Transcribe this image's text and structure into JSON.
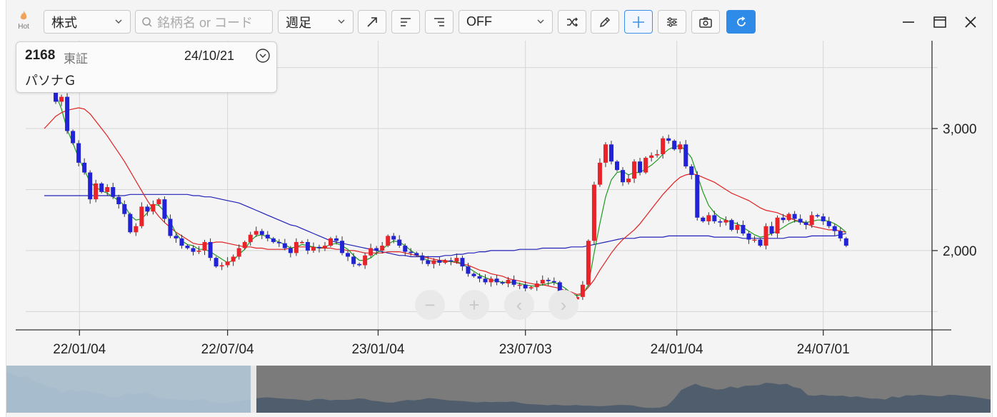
{
  "toolbar": {
    "hot_label": "Hot",
    "market_select": "株式",
    "search_placeholder": "銘柄名 or コード",
    "period_select": "週足",
    "indicator_select": "OFF"
  },
  "info_card": {
    "code": "2168",
    "exchange": "東証",
    "date": "24/10/21",
    "name": "パソナＧ"
  },
  "colors": {
    "up": "#e8232a",
    "down": "#2323d6",
    "ma_short": "#1f9a1f",
    "ma_mid": "#e02020",
    "ma_long": "#2020b8",
    "accent": "#2e8be8"
  },
  "chart_data": {
    "type": "candlestick",
    "y_ticks": [
      "3,000",
      "2,000"
    ],
    "x_ticks": [
      "22/01/04",
      "22/07/04",
      "23/01/04",
      "23/07/03",
      "24/01/04",
      "24/07/01"
    ],
    "ylim": [
      1350,
      3720
    ],
    "x_start": "2021-11-22",
    "x_interval": "weekly",
    "close": [
      3450,
      3350,
      3220,
      3260,
      2980,
      2880,
      2720,
      2640,
      2420,
      2550,
      2480,
      2520,
      2440,
      2380,
      2300,
      2150,
      2200,
      2360,
      2320,
      2380,
      2420,
      2260,
      2120,
      2100,
      2040,
      2020,
      1990,
      2000,
      2070,
      1940,
      1870,
      1880,
      1910,
      1950,
      2020,
      2070,
      2130,
      2160,
      2130,
      2100,
      2070,
      2060,
      2020,
      1980,
      2070,
      2070,
      2000,
      2030,
      2020,
      2040,
      2100,
      2080,
      1980,
      1950,
      1890,
      1880,
      1960,
      2020,
      2000,
      2040,
      2120,
      2090,
      2040,
      1990,
      1980,
      1960,
      1920,
      1890,
      1920,
      1900,
      1920,
      1910,
      1940,
      1870,
      1810,
      1790,
      1770,
      1740,
      1770,
      1740,
      1730,
      1760,
      1720,
      1720,
      1690,
      1700,
      1730,
      1760,
      1750,
      1740,
      1660,
      1610,
      1600,
      1620,
      1720,
      2080,
      2540,
      2720,
      2870,
      2730,
      2660,
      2560,
      2590,
      2730,
      2640,
      2760,
      2780,
      2790,
      2920,
      2900,
      2830,
      2870,
      2690,
      2620,
      2270,
      2240,
      2290,
      2240,
      2230,
      2250,
      2170,
      2210,
      2140,
      2090,
      2090,
      2040,
      2200,
      2140,
      2270,
      2250,
      2300,
      2260,
      2230,
      2210,
      2290,
      2280,
      2240,
      2200,
      2160,
      2100,
      2040
    ],
    "ma_short": [
      3430,
      3380,
      3280,
      3160,
      2990,
      2880,
      2760,
      2660,
      2560,
      2520,
      2490,
      2470,
      2440,
      2410,
      2370,
      2290,
      2250,
      2260,
      2310,
      2380,
      2370,
      2320,
      2240,
      2140,
      2080,
      2050,
      2040,
      2010,
      2010,
      1990,
      1960,
      1930,
      1900,
      1920,
      1970,
      2010,
      2080,
      2120,
      2130,
      2110,
      2090,
      2070,
      2050,
      2020,
      2030,
      2050,
      2040,
      2030,
      2020,
      2030,
      2050,
      2060,
      2040,
      2010,
      1960,
      1920,
      1920,
      1940,
      1980,
      2010,
      2050,
      2080,
      2070,
      2040,
      2000,
      1970,
      1940,
      1920,
      1910,
      1910,
      1910,
      1910,
      1910,
      1890,
      1860,
      1830,
      1800,
      1780,
      1760,
      1750,
      1740,
      1740,
      1740,
      1730,
      1720,
      1710,
      1710,
      1720,
      1730,
      1740,
      1720,
      1690,
      1650,
      1630,
      1640,
      1720,
      1980,
      2220,
      2440,
      2580,
      2640,
      2650,
      2620,
      2640,
      2640,
      2670,
      2700,
      2740,
      2790,
      2830,
      2850,
      2860,
      2820,
      2760,
      2620,
      2480,
      2370,
      2310,
      2270,
      2250,
      2230,
      2220,
      2190,
      2160,
      2130,
      2110,
      2120,
      2140,
      2160,
      2190,
      2220,
      2240,
      2240,
      2230,
      2240,
      2250,
      2250,
      2240,
      2220,
      2190,
      2150
    ],
    "ma_mid": [
      3000,
      3050,
      3100,
      3130,
      3150,
      3160,
      3170,
      3160,
      3120,
      3060,
      3000,
      2940,
      2870,
      2800,
      2730,
      2650,
      2570,
      2490,
      2410,
      2340,
      2280,
      2230,
      2190,
      2150,
      2120,
      2090,
      2060,
      2050,
      2050,
      2060,
      2070,
      2070,
      2060,
      2050,
      2040,
      2030,
      2030,
      2020,
      2020,
      2010,
      2010,
      2010,
      2010,
      2020,
      2030,
      2030,
      2030,
      2030,
      2020,
      2020,
      2020,
      2010,
      2010,
      2000,
      2000,
      1990,
      1980,
      1980,
      1980,
      1980,
      1990,
      1990,
      1990,
      1980,
      1970,
      1960,
      1950,
      1940,
      1930,
      1920,
      1920,
      1910,
      1900,
      1890,
      1880,
      1860,
      1840,
      1830,
      1810,
      1800,
      1790,
      1770,
      1760,
      1750,
      1740,
      1730,
      1720,
      1720,
      1710,
      1700,
      1690,
      1670,
      1660,
      1640,
      1650,
      1700,
      1760,
      1840,
      1910,
      1980,
      2040,
      2090,
      2130,
      2170,
      2220,
      2280,
      2340,
      2400,
      2460,
      2510,
      2560,
      2600,
      2620,
      2630,
      2620,
      2600,
      2580,
      2560,
      2530,
      2500,
      2470,
      2450,
      2430,
      2410,
      2380,
      2350,
      2330,
      2320,
      2310,
      2290,
      2270,
      2250,
      2240,
      2220,
      2200,
      2190,
      2180,
      2170,
      2170,
      2160,
      2150
    ],
    "ma_long": [
      2450,
      2450,
      2450,
      2450,
      2450,
      2450,
      2450,
      2450,
      2450,
      2450,
      2450,
      2450,
      2450,
      2450,
      2450,
      2460,
      2460,
      2460,
      2460,
      2460,
      2460,
      2460,
      2460,
      2460,
      2460,
      2460,
      2450,
      2450,
      2440,
      2440,
      2430,
      2420,
      2410,
      2400,
      2390,
      2370,
      2350,
      2330,
      2310,
      2290,
      2270,
      2250,
      2230,
      2210,
      2200,
      2180,
      2160,
      2140,
      2120,
      2100,
      2080,
      2070,
      2060,
      2050,
      2040,
      2030,
      2020,
      2010,
      2000,
      1990,
      1980,
      1970,
      1960,
      1960,
      1950,
      1950,
      1950,
      1950,
      1950,
      1950,
      1960,
      1960,
      1970,
      1970,
      1980,
      1980,
      1990,
      1990,
      2000,
      2000,
      2000,
      2000,
      2000,
      2010,
      2010,
      2010,
      2010,
      2020,
      2020,
      2020,
      2020,
      2020,
      2030,
      2030,
      2030,
      2040,
      2050,
      2060,
      2070,
      2080,
      2090,
      2100,
      2100,
      2100,
      2110,
      2110,
      2110,
      2110,
      2110,
      2120,
      2120,
      2120,
      2120,
      2120,
      2120,
      2120,
      2120,
      2110,
      2110,
      2110,
      2110,
      2110,
      2100,
      2100,
      2100,
      2100,
      2100,
      2100,
      2100,
      2100,
      2110,
      2110,
      2110,
      2110,
      2120,
      2120,
      2120,
      2120,
      2120,
      2130,
      2140
    ]
  }
}
